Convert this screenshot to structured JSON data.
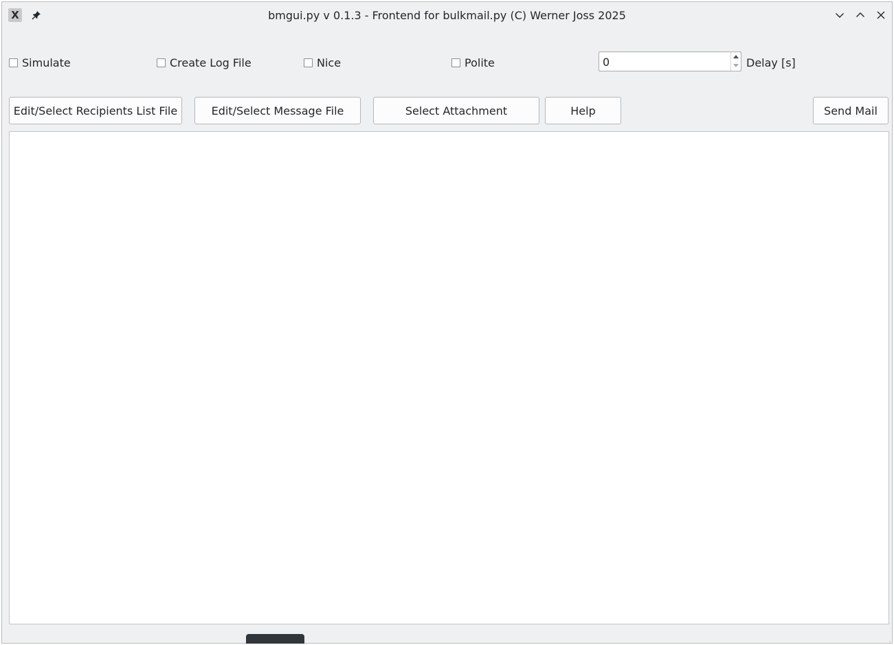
{
  "window": {
    "title": "bmgui.py v 0.1.3 - Frontend for bulkmail.py (C) Werner Joss 2025",
    "app_icon_glyph": "X",
    "icons": {
      "app": "x-app-icon",
      "pin": "pin-icon",
      "minimize": "chevron-down-icon",
      "maximize": "chevron-up-icon",
      "close": "close-icon"
    }
  },
  "options": {
    "simulate": {
      "label": "Simulate",
      "checked": false
    },
    "create_log": {
      "label": "Create Log File",
      "checked": false
    },
    "nice": {
      "label": "Nice",
      "checked": false
    },
    "polite": {
      "label": "Polite",
      "checked": false
    }
  },
  "delay": {
    "value": "0",
    "label": "Delay [s]"
  },
  "buttons": {
    "recipients": "Edit/Select Recipients List File",
    "message": "Edit/Select Message File",
    "attachment": "Select Attachment",
    "help": "Help",
    "send": "Send Mail"
  },
  "output": {
    "text": ""
  }
}
